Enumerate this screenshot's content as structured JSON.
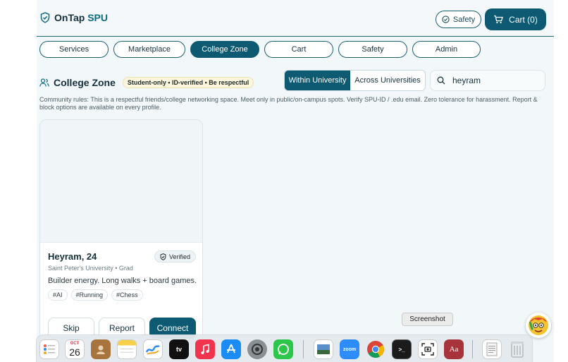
{
  "header": {
    "brand_main": "OnTap",
    "brand_accent": "SPU",
    "safety_label": "Safety",
    "cart_label": "Cart (0)"
  },
  "nav": {
    "tabs": [
      {
        "label": "Services"
      },
      {
        "label": "Marketplace"
      },
      {
        "label": "College Zone"
      },
      {
        "label": "Cart"
      },
      {
        "label": "Safety"
      },
      {
        "label": "Admin"
      }
    ],
    "active_tab": "College Zone"
  },
  "college_zone": {
    "title": "College Zone",
    "rules_badge": "Student-only • ID-verified • Be respectful",
    "scope_options": [
      "Within University",
      "Across Universities"
    ],
    "scope_selected": "Within University",
    "search_value": "heyram",
    "community_rules": "Community rules: This is a respectful friends/college networking space. Meet only in public/on-campus spots. Verify SPU-ID / .edu email. Zero tolerance for harassment. Report & block options are available on every profile."
  },
  "profile_card": {
    "name": "Heyram, 24",
    "verified_label": "Verified",
    "school": "Saint Peter's University • Grad",
    "bio": "Builder energy. Long walks + board games.",
    "tags": [
      "#AI",
      "#Running",
      "#Chess"
    ],
    "actions": {
      "skip": "Skip",
      "report": "Report",
      "connect": "Connect"
    }
  },
  "tooltip": {
    "label": "Screenshot"
  },
  "dock": {
    "calendar_month": "OCT",
    "calendar_day": "26",
    "tv_label": "tv",
    "zoom_label": "zoom",
    "terminal_label": ">_",
    "dictionary_label": "Aa",
    "apps": [
      "reminders-icon",
      "calendar-icon",
      "contacts-icon",
      "notes-icon",
      "freeform-icon",
      "apple-tv-icon",
      "music-icon",
      "app-store-icon",
      "system-settings-icon",
      "whatsapp-icon",
      "preview-icon",
      "zoom-icon",
      "chrome-icon",
      "terminal-icon",
      "screenshot-icon",
      "dictionary-icon",
      "textedit-icon",
      "trash-icon"
    ]
  },
  "colors": {
    "primary": "#0d5a72",
    "background": "#f2f7f9",
    "badge_bg": "#fbf6dc"
  }
}
